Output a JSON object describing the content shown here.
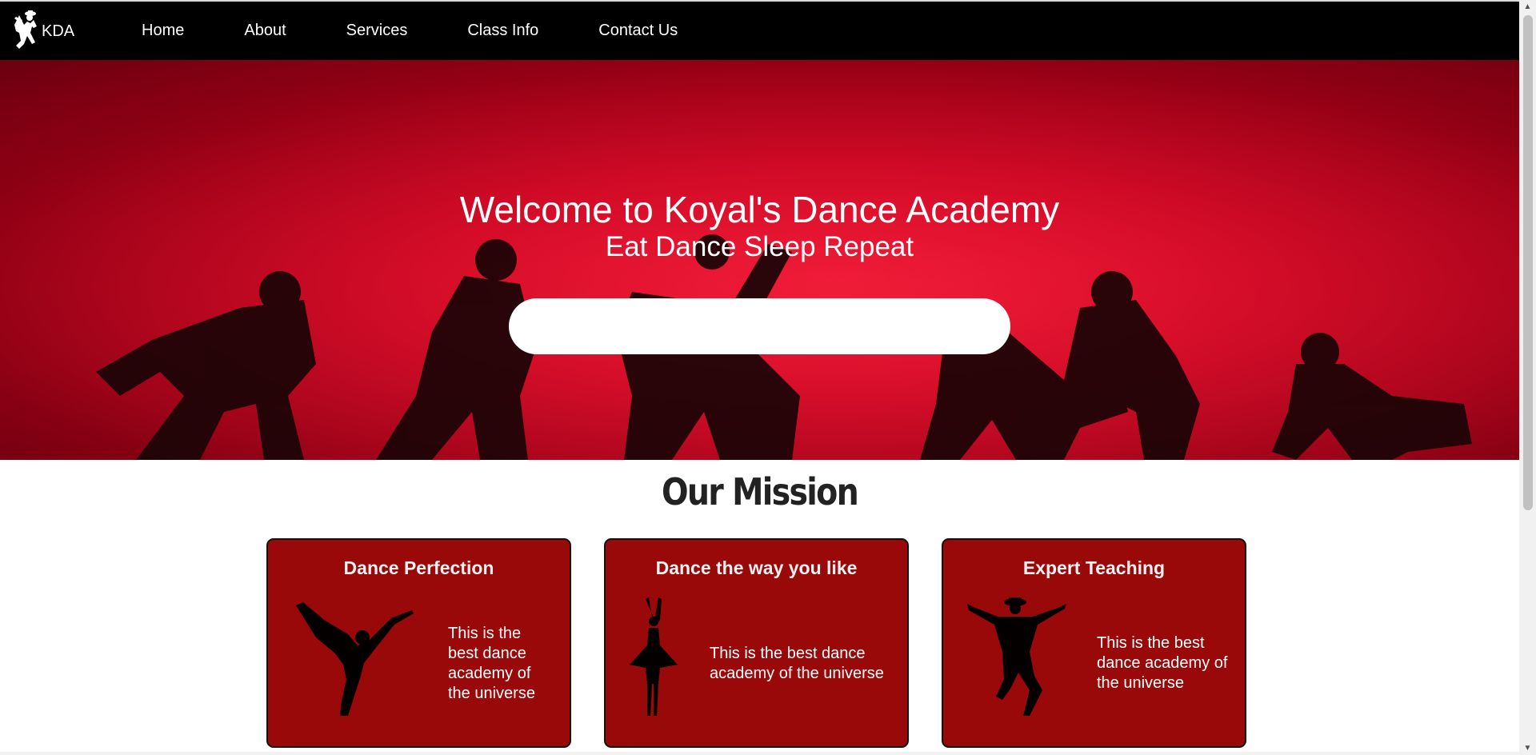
{
  "nav": {
    "brand": "KDA",
    "links": [
      "Home",
      "About",
      "Services",
      "Class Info",
      "Contact Us"
    ]
  },
  "hero": {
    "title": "Welcome to Koyal's Dance Academy",
    "subtitle": "Eat Dance Sleep Repeat",
    "search_value": "",
    "search_placeholder": ""
  },
  "mission": {
    "title": "Our Mission",
    "cards": [
      {
        "title": "Dance Perfection",
        "text": "This is the best dance academy of the universe",
        "icon": "ballerina-arabesque-icon"
      },
      {
        "title": "Dance the way you like",
        "text": "This is the best dance academy of the universe",
        "icon": "ballerina-pointe-icon"
      },
      {
        "title": "Expert Teaching",
        "text": "This is the best dance academy of the universe",
        "icon": "hat-dancer-icon"
      }
    ]
  },
  "colors": {
    "nav_bg": "#000000",
    "hero_red": "#c2001c",
    "card_bg": "#990909",
    "text_light": "#ffffff"
  }
}
